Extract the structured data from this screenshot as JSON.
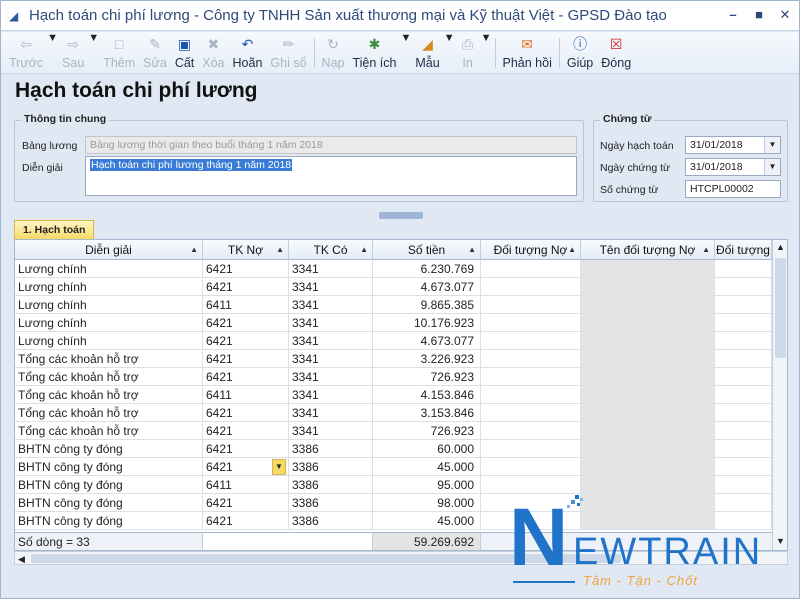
{
  "window": {
    "title": "Hạch toán chi phí lương - Công ty TNHH Sản xuất thương mại và Kỹ thuật Việt - GPSD Đào tạo"
  },
  "toolbar": {
    "items": [
      {
        "label": "Trước",
        "icon": "arrow-left-icon",
        "enabled": false
      },
      {
        "label": "Sau",
        "icon": "arrow-right-icon",
        "enabled": false
      },
      {
        "label": "Thêm",
        "icon": "new-doc-icon",
        "enabled": false
      },
      {
        "label": "Sửa",
        "icon": "edit-doc-icon",
        "enabled": false
      },
      {
        "label": "Cất",
        "icon": "save-icon",
        "enabled": true
      },
      {
        "label": "Xóa",
        "icon": "delete-icon",
        "enabled": false
      },
      {
        "label": "Hoãn",
        "icon": "undo-icon",
        "enabled": true
      },
      {
        "label": "Ghi sổ",
        "icon": "pencil-icon",
        "enabled": false
      },
      {
        "label": "Nạp",
        "icon": "reload-icon",
        "enabled": false
      },
      {
        "label": "Tiện ích",
        "icon": "utility-icon",
        "enabled": true
      },
      {
        "label": "Mẫu",
        "icon": "template-icon",
        "enabled": true
      },
      {
        "label": "In",
        "icon": "print-icon",
        "enabled": false
      },
      {
        "label": "Phản hồi",
        "icon": "feedback-icon",
        "enabled": true
      },
      {
        "label": "Giúp",
        "icon": "help-icon",
        "enabled": true
      },
      {
        "label": "Đóng",
        "icon": "close-icon",
        "enabled": true
      }
    ]
  },
  "page": {
    "title": "Hạch toán chi phí lương"
  },
  "general": {
    "group_title": "Thông tin chung",
    "payroll_label": "Bảng lương",
    "payroll_value": "Bảng lương thời gian theo buổi tháng 1 năm 2018",
    "desc_label": "Diễn giải",
    "desc_value": "Hạch toán chi phí lương tháng 1 năm 2018"
  },
  "voucher": {
    "group_title": "Chứng từ",
    "posting_date_label": "Ngày hạch toán",
    "posting_date": "31/01/2018",
    "voucher_date_label": "Ngày chứng từ",
    "voucher_date": "31/01/2018",
    "voucher_no_label": "Số chứng từ",
    "voucher_no": "HTCPL00002"
  },
  "tab": {
    "label": "1. Hạch toán"
  },
  "grid": {
    "columns": [
      "Diễn giải",
      "TK Nợ",
      "TK Có",
      "Số tiền",
      "Đối tượng Nợ",
      "Tên đối tượng Nợ",
      "Đối tượng"
    ],
    "rows": [
      [
        "Lương chính",
        "6421",
        "3341",
        "6.230.769"
      ],
      [
        "Lương chính",
        "6421",
        "3341",
        "4.673.077"
      ],
      [
        "Lương chính",
        "6411",
        "3341",
        "9.865.385"
      ],
      [
        "Lương chính",
        "6421",
        "3341",
        "10.176.923"
      ],
      [
        "Lương chính",
        "6421",
        "3341",
        "4.673.077"
      ],
      [
        "Tổng các khoản hỗ trợ",
        "6421",
        "3341",
        "3.226.923"
      ],
      [
        "Tổng các khoản hỗ trợ",
        "6421",
        "3341",
        "726.923"
      ],
      [
        "Tổng các khoản hỗ trợ",
        "6411",
        "3341",
        "4.153.846"
      ],
      [
        "Tổng các khoản hỗ trợ",
        "6421",
        "3341",
        "3.153.846"
      ],
      [
        "Tổng các khoản hỗ trợ",
        "6421",
        "3341",
        "726.923"
      ],
      [
        "BHTN công ty đóng",
        "6421",
        "3386",
        "60.000"
      ],
      [
        "BHTN công ty đóng",
        "6421",
        "3386",
        "45.000"
      ],
      [
        "BHTN công ty đóng",
        "6411",
        "3386",
        "95.000"
      ],
      [
        "BHTN công ty đóng",
        "6421",
        "3386",
        "98.000"
      ],
      [
        "BHTN công ty đóng",
        "6421",
        "3386",
        "45.000"
      ]
    ],
    "footer_count": "Số dòng = 33",
    "footer_total": "59.269.692"
  },
  "logo": {
    "brand": "NEWTRAIN",
    "slogan": "Tâm - Tận - Chốt"
  },
  "colors": {
    "accent": "#1f73c8",
    "tab": "#f7d968",
    "slogan": "#f2a33a"
  }
}
